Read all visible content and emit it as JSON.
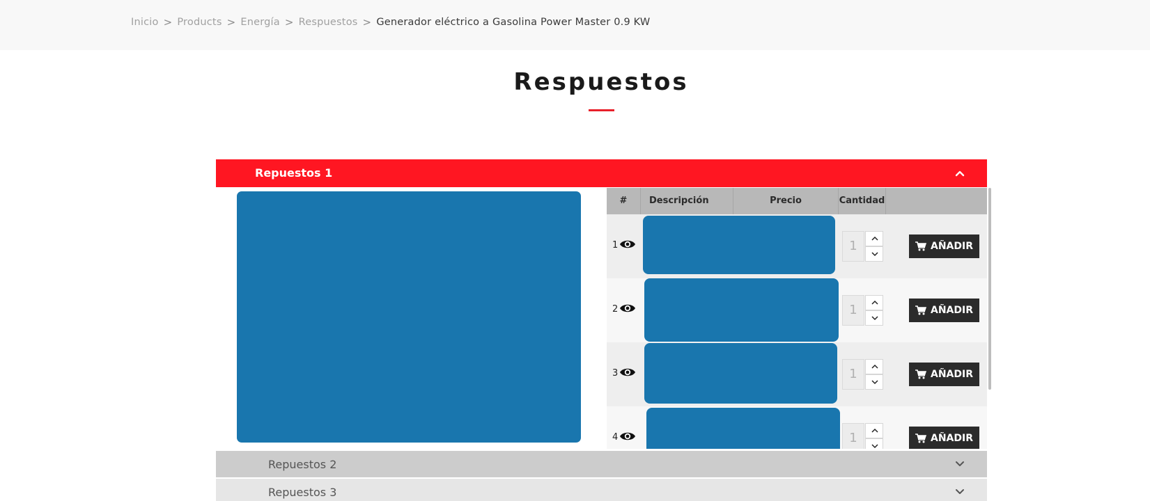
{
  "breadcrumb": {
    "items": [
      "Inicio",
      "Products",
      "Energía",
      "Respuestos"
    ],
    "current": "Generador eléctrico a Gasolina Power Master 0.9 KW",
    "separator": ">"
  },
  "page": {
    "title": "Respuestos",
    "accent_color": "#e8202a"
  },
  "accordion": {
    "open_section": {
      "label": "Repuestos 1",
      "color": "#ff1622",
      "icon": "chevron-up-icon"
    },
    "closed_sections": [
      {
        "label": "Repuestos 2",
        "icon": "chevron-down-icon"
      },
      {
        "label": "Repuestos 3",
        "icon": "chevron-down-icon"
      }
    ]
  },
  "table": {
    "headers": {
      "num": "#",
      "description": "Descripción",
      "price": "Precio",
      "quantity": "Cantidad",
      "actions": ""
    },
    "rows": [
      {
        "num": "1",
        "quantity": "1",
        "add_label": "AÑADIR",
        "view_icon": "eye-icon"
      },
      {
        "num": "2",
        "quantity": "1",
        "add_label": "AÑADIR",
        "view_icon": "eye-icon"
      },
      {
        "num": "3",
        "quantity": "1",
        "add_label": "AÑADIR",
        "view_icon": "eye-icon"
      },
      {
        "num": "4",
        "quantity": "1",
        "add_label": "AÑADIR",
        "view_icon": "eye-icon"
      }
    ]
  },
  "colors": {
    "image_placeholder": "#1976ae",
    "button_bg": "#2b2b2b",
    "header_bg": "#b8b8b8"
  }
}
